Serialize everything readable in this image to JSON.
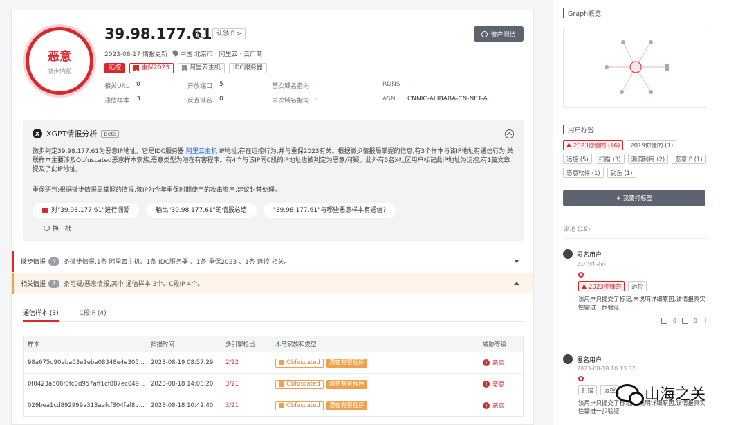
{
  "verdict": {
    "label": "恶意",
    "sub": "微步情报"
  },
  "ip": {
    "address": "39.98.177.61",
    "claim": "认领IP >",
    "report": "资产测绘"
  },
  "meta": {
    "updated": "2023-08-17 情报更新",
    "location": "中国 北京市 · 阿里云 · 云厂商"
  },
  "tags": [
    "远控",
    "重保2023",
    "阿里云主机",
    "IDC服务器"
  ],
  "stats": {
    "related_url_k": "相关URL",
    "related_url_v": "0",
    "open_port_k": "开放端口",
    "open_port_v": "5",
    "first_domain_k": "首次域名指向",
    "first_domain_v": "-",
    "rdns_k": "RDNS",
    "rdns_v": "-",
    "comm_k": "通信样本",
    "comm_v": "3",
    "rev_domain_k": "反查域名",
    "rev_domain_v": "0",
    "last_domain_k": "末次域名指向",
    "last_domain_v": "-",
    "asn_k": "ASN",
    "asn_v": "CNNIC-ALIBABA-CN-NET-A..."
  },
  "xgpt": {
    "title": "XGPT情报分析",
    "beta": "beta",
    "p1a": "微步判定39.98.177.61为恶意IP地址。它是IDC服务器,",
    "p1hl": "阿里云主机",
    "p1b": " IP地址,存在远控行为,并与重保2023有关。根据微步情报局掌握的信息,有3个样本与该IP地址有通信行为,关联样本主要涉及Obfuscated恶意样本家族,恶意类型为潜在有害程序。有4个与该IP同C段的IP地址也被判定为恶意/可疑。此外有5名X社区用户标记此IP地址为远控,有1篇文章提及了此IP地址。",
    "p2": "重保研判:根据微步情报局掌握的情报,该IP为今年重保时期使用的攻击资产,建议封禁处理。",
    "asks": [
      "对\"39.98.177.61\"进行溯源",
      "输出\"39.98.177.61\"的情报总结",
      "\"39.98.177.61\"与哪些恶意样本有通信?"
    ],
    "refresh": "换一批"
  },
  "sections": [
    {
      "title": "微步情报",
      "count": "4",
      "text": "条微步情报,1条 阿里云主机、1条 IDC服务器 、1条 重保2023 、1条 远控 相关。"
    },
    {
      "title": "相关情报",
      "count": "7",
      "text": "条可疑/恶意情报,其中 通信样本 3个、C段IP 4个。"
    }
  ],
  "tabs": [
    "通信样本 (3)",
    "C段IP (4)"
  ],
  "table": {
    "headers": [
      "样本",
      "扫描时间",
      "多引擎检出",
      "木马家族和类型",
      "威胁等级"
    ],
    "rows": [
      {
        "sample": "98a675d90eba03e1ebe08348e4e305...",
        "time": "2023-08-19 08:57:29",
        "det": "2/22",
        "family": "Obfuscated",
        "type": "潜在有害程序",
        "level": "恶意"
      },
      {
        "sample": "0f0423a606f0fc0d957aff1cf887ec049...",
        "time": "2023-08-18 14:08:20",
        "det": "3/21",
        "family": "Obfuscated",
        "type": "潜在有害程序",
        "level": "恶意"
      },
      {
        "sample": "029bea1cd892999a313aefcf804faf8b...",
        "time": "2023-08-18 10:42:40",
        "det": "3/21",
        "family": "Obfuscated",
        "type": "潜在有害程序",
        "level": "恶意"
      }
    ]
  },
  "right": {
    "graph_title": "Graph概览",
    "utag_title": "用户标签",
    "user_tags": [
      "2023你懂的 (16)",
      "2019你懂的 (1)",
      "远控 (5)",
      "扫描 (3)",
      "漏洞利用 (2)",
      "恶意IP (1)",
      "恶意软件 (1)",
      "钓鱼 (1)"
    ],
    "tag_button": "+ 我要打标签",
    "comments_title": "评论 (19)",
    "comments": [
      {
        "user": "匿名用户",
        "time": "21小时以前",
        "tags": [
          "2023你懂的",
          "远控"
        ],
        "body": "该用户只提交了标记,未说明详细原因,该情报真实性需进一步验证",
        "up": "0",
        "down": "0"
      },
      {
        "user": "匿名用户",
        "time": "2023-08-18 10:13:32",
        "tags": [
          "扫描",
          "远控"
        ],
        "body": "该用户只提交了标记,未说明详细原因,该情报真实性需进一步验证"
      }
    ],
    "watermark": "山海之关"
  },
  "colors": {
    "malicious": "#d9272e",
    "warning": "#f0a04b",
    "button": "#5d6470"
  }
}
